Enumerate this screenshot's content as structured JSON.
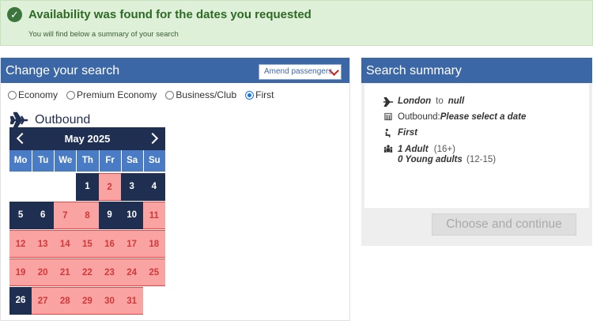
{
  "banner": {
    "title": "Availability was found for the dates you requested",
    "subtitle": "You will find below a summary of your search",
    "status_color": "#3c763d"
  },
  "change_search": {
    "title": "Change your search",
    "amend_label": "Amend passengers",
    "cabins": [
      {
        "label": "Economy",
        "selected": false
      },
      {
        "label": "Premium Economy",
        "selected": false
      },
      {
        "label": "Business/Club",
        "selected": false
      },
      {
        "label": "First",
        "selected": true
      }
    ],
    "outbound_label": "Outbound",
    "calendar": {
      "month": "May 2025",
      "days_of_week": [
        "Mo",
        "Tu",
        "We",
        "Th",
        "Fr",
        "Sa",
        "Su"
      ],
      "weeks": [
        [
          null,
          null,
          null,
          {
            "d": "1",
            "s": "avail"
          },
          {
            "d": "2",
            "s": "unavail"
          },
          {
            "d": "3",
            "s": "avail"
          },
          {
            "d": "4",
            "s": "avail"
          }
        ],
        [
          {
            "d": "5",
            "s": "avail"
          },
          {
            "d": "6",
            "s": "avail"
          },
          {
            "d": "7",
            "s": "unavail"
          },
          {
            "d": "8",
            "s": "unavail"
          },
          {
            "d": "9",
            "s": "avail"
          },
          {
            "d": "10",
            "s": "avail"
          },
          {
            "d": "11",
            "s": "unavail"
          }
        ],
        [
          {
            "d": "12",
            "s": "unavail"
          },
          {
            "d": "13",
            "s": "unavail"
          },
          {
            "d": "14",
            "s": "unavail"
          },
          {
            "d": "15",
            "s": "unavail"
          },
          {
            "d": "16",
            "s": "unavail"
          },
          {
            "d": "17",
            "s": "unavail"
          },
          {
            "d": "18",
            "s": "unavail"
          }
        ],
        [
          {
            "d": "19",
            "s": "unavail"
          },
          {
            "d": "20",
            "s": "unavail"
          },
          {
            "d": "21",
            "s": "unavail"
          },
          {
            "d": "22",
            "s": "unavail"
          },
          {
            "d": "23",
            "s": "unavail"
          },
          {
            "d": "24",
            "s": "unavail"
          },
          {
            "d": "25",
            "s": "unavail"
          }
        ],
        [
          {
            "d": "26",
            "s": "avail"
          },
          {
            "d": "27",
            "s": "unavail"
          },
          {
            "d": "28",
            "s": "unavail"
          },
          {
            "d": "29",
            "s": "unavail"
          },
          {
            "d": "30",
            "s": "unavail"
          },
          {
            "d": "31",
            "s": "unavail"
          },
          null
        ]
      ]
    }
  },
  "summary": {
    "title": "Search summary",
    "from": "London",
    "to_word": "to",
    "to": "null",
    "outbound_label": "Outbound:",
    "outbound_value": "Please select a date",
    "cabin": "First",
    "adults": "1 Adult",
    "adults_age": "(16+)",
    "young": "0 Young adults",
    "young_age": "(12-15)"
  },
  "continue_label": "Choose and continue",
  "colors": {
    "header_blue": "#3c67a7",
    "navy": "#1f2f52",
    "unavailable_pink": "#f9a3a3"
  }
}
